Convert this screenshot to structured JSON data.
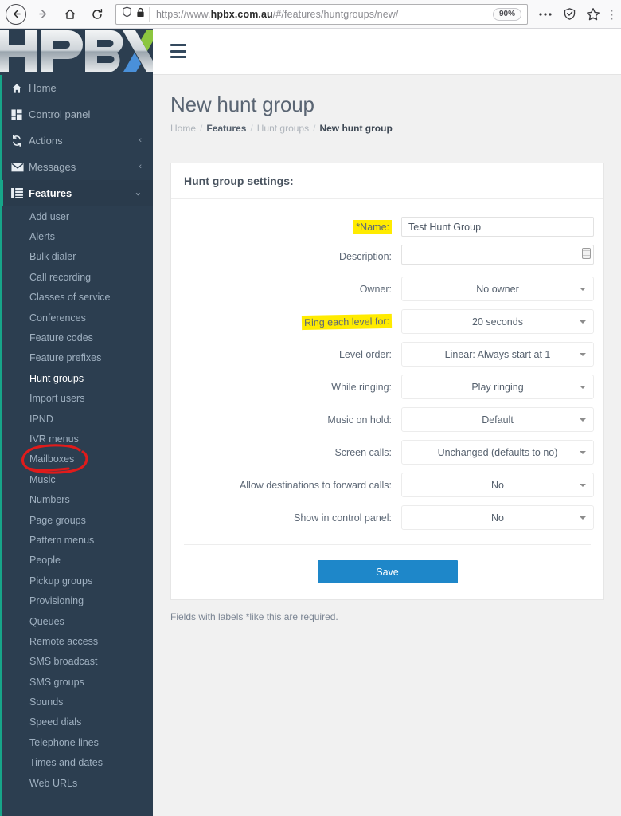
{
  "browser": {
    "url_prefix": "https://www.",
    "url_host": "hpbx.com.au",
    "url_suffix": "/#/features/huntgroups/new/",
    "zoom_level": "90%",
    "back_icon": "back-arrow-icon",
    "forward_icon": "forward-arrow-icon",
    "home_icon": "home-icon",
    "reload_icon": "reload-icon",
    "shield_icon": "shield-icon",
    "lock_icon": "padlock-icon",
    "overflow_icon": "ellipsis-icon",
    "tracking_icon": "tracking-protection-icon",
    "bookmark_icon": "star-icon"
  },
  "brand": {
    "logo_text_main": "HPB",
    "logo_text_accent": "X",
    "sidebar_bg": "#2c3e50",
    "accent_green": "#8cc63f",
    "accent_blue": "#4a90d9",
    "active_teal": "#17a589",
    "primary_blue": "#1e87c9",
    "highlight_yellow": "#ffeb00",
    "annotation_red": "#e01b1b"
  },
  "topbar": {
    "menu_toggle_icon": "hamburger-icon"
  },
  "sidebar": {
    "items": [
      {
        "label": "Home",
        "icon": "home-icon",
        "caret": "",
        "active": false
      },
      {
        "label": "Control panel",
        "icon": "dashboard-icon",
        "caret": "",
        "active": false
      },
      {
        "label": "Actions",
        "icon": "sync-icon",
        "caret": "‹",
        "active": false
      },
      {
        "label": "Messages",
        "icon": "envelope-icon",
        "caret": "‹",
        "active": false
      },
      {
        "label": "Features",
        "icon": "list-icon",
        "caret": "⌄",
        "active": true
      }
    ],
    "subitems": [
      {
        "label": "Add user",
        "selected": false
      },
      {
        "label": "Alerts",
        "selected": false
      },
      {
        "label": "Bulk dialer",
        "selected": false
      },
      {
        "label": "Call recording",
        "selected": false
      },
      {
        "label": "Classes of service",
        "selected": false
      },
      {
        "label": "Conferences",
        "selected": false
      },
      {
        "label": "Feature codes",
        "selected": false
      },
      {
        "label": "Feature prefixes",
        "selected": false
      },
      {
        "label": "Hunt groups",
        "selected": true
      },
      {
        "label": "Import users",
        "selected": false
      },
      {
        "label": "IPND",
        "selected": false
      },
      {
        "label": "IVR menus",
        "selected": false
      },
      {
        "label": "Mailboxes",
        "selected": false
      },
      {
        "label": "Music",
        "selected": false
      },
      {
        "label": "Numbers",
        "selected": false
      },
      {
        "label": "Page groups",
        "selected": false
      },
      {
        "label": "Pattern menus",
        "selected": false
      },
      {
        "label": "People",
        "selected": false
      },
      {
        "label": "Pickup groups",
        "selected": false
      },
      {
        "label": "Provisioning",
        "selected": false
      },
      {
        "label": "Queues",
        "selected": false
      },
      {
        "label": "Remote access",
        "selected": false
      },
      {
        "label": "SMS broadcast",
        "selected": false
      },
      {
        "label": "SMS groups",
        "selected": false
      },
      {
        "label": "Sounds",
        "selected": false
      },
      {
        "label": "Speed dials",
        "selected": false
      },
      {
        "label": "Telephone lines",
        "selected": false
      },
      {
        "label": "Times and dates",
        "selected": false
      },
      {
        "label": "Web URLs",
        "selected": false
      }
    ],
    "annotation": "red-ellipse-around-hunt-groups"
  },
  "page": {
    "title": "New hunt group",
    "breadcrumb": [
      {
        "label": "Home",
        "style": "muted"
      },
      {
        "label": "Features",
        "style": "strong"
      },
      {
        "label": "Hunt groups",
        "style": "muted"
      },
      {
        "label": "New hunt group",
        "style": "current"
      }
    ],
    "breadcrumb_separator": "/"
  },
  "panel": {
    "header": "Hunt group settings:",
    "fields": [
      {
        "label": "*Name:",
        "type": "text",
        "value": "Test Hunt Group",
        "placeholder": "",
        "highlight": "yellow",
        "highlight_slant": false,
        "name": "name-field"
      },
      {
        "label": "Description:",
        "type": "textarea",
        "value": "",
        "placeholder": "",
        "highlight": "none",
        "highlight_slant": false,
        "name": "description-field"
      },
      {
        "label": "Owner:",
        "type": "select",
        "value": "No owner",
        "highlight": "none",
        "highlight_slant": false,
        "name": "owner-select"
      },
      {
        "label": "Ring each level for:",
        "type": "select",
        "value": "20 seconds",
        "highlight": "yellow",
        "highlight_slant": true,
        "name": "ring-each-level-for-select"
      },
      {
        "label": "Level order:",
        "type": "select",
        "value": "Linear: Always start at 1",
        "highlight": "none",
        "highlight_slant": false,
        "name": "level-order-select"
      },
      {
        "label": "While ringing:",
        "type": "select",
        "value": "Play ringing",
        "highlight": "none",
        "highlight_slant": false,
        "name": "while-ringing-select"
      },
      {
        "label": "Music on hold:",
        "type": "select",
        "value": "Default",
        "highlight": "none",
        "highlight_slant": false,
        "name": "music-on-hold-select"
      },
      {
        "label": "Screen calls:",
        "type": "select",
        "value": "Unchanged (defaults to no)",
        "highlight": "none",
        "highlight_slant": false,
        "name": "screen-calls-select"
      },
      {
        "label": "Allow destinations to forward calls:",
        "type": "select",
        "value": "No",
        "highlight": "none",
        "highlight_slant": false,
        "name": "allow-forward-calls-select"
      },
      {
        "label": "Show in control panel:",
        "type": "select",
        "value": "No",
        "highlight": "none",
        "highlight_slant": false,
        "name": "show-in-control-panel-select"
      }
    ],
    "save_label": "Save"
  },
  "footer": {
    "required_note": "Fields with labels *like this are required."
  }
}
